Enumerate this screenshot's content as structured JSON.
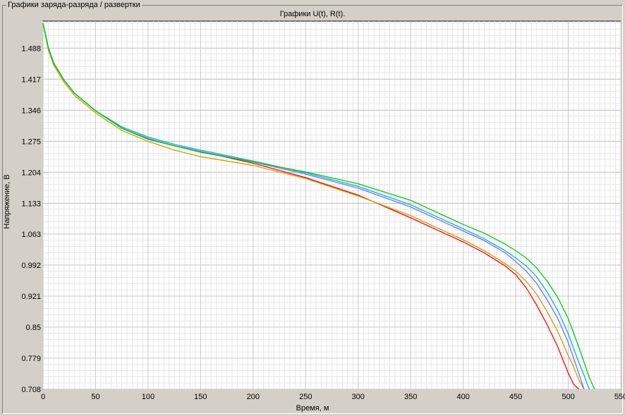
{
  "window": {
    "group_caption": "Графики заряда-разряда / развертки"
  },
  "chart_data": {
    "type": "line",
    "title": "Графики U(t), R(t).",
    "xlabel": "Время, м",
    "ylabel": "Напряжение, В",
    "xlim": [
      0,
      550
    ],
    "ylim": [
      0.708,
      1.55
    ],
    "x_ticks": [
      0,
      50,
      100,
      150,
      200,
      250,
      300,
      350,
      400,
      450,
      500,
      550
    ],
    "y_ticks": [
      0.708,
      0.779,
      0.85,
      0.921,
      0.992,
      1.063,
      1.133,
      1.204,
      1.275,
      1.346,
      1.417,
      1.488
    ],
    "grid": true,
    "legend": "none",
    "series": [
      {
        "color": "#ff0000",
        "x": [
          0,
          5,
          10,
          20,
          30,
          50,
          75,
          100,
          125,
          150,
          200,
          250,
          300,
          350,
          400,
          420,
          440,
          450,
          460,
          470,
          480,
          490,
          500,
          505,
          510
        ],
        "y": [
          1.545,
          1.49,
          1.455,
          1.415,
          1.385,
          1.345,
          1.305,
          1.28,
          1.265,
          1.252,
          1.225,
          1.192,
          1.152,
          1.1,
          1.045,
          1.02,
          0.99,
          0.97,
          0.94,
          0.9,
          0.855,
          0.805,
          0.745,
          0.72,
          0.708
        ]
      },
      {
        "color": "#c8a000",
        "x": [
          0,
          5,
          10,
          20,
          30,
          50,
          75,
          100,
          125,
          150,
          200,
          250,
          300,
          350,
          400,
          420,
          440,
          450,
          460,
          470,
          480,
          490,
          500,
          505,
          510,
          515
        ],
        "y": [
          1.545,
          1.485,
          1.45,
          1.41,
          1.38,
          1.34,
          1.3,
          1.275,
          1.255,
          1.24,
          1.22,
          1.19,
          1.15,
          1.105,
          1.05,
          1.025,
          0.995,
          0.978,
          0.955,
          0.925,
          0.885,
          0.84,
          0.785,
          0.76,
          0.73,
          0.708
        ]
      },
      {
        "color": "#7070ff",
        "x": [
          0,
          5,
          10,
          20,
          30,
          50,
          75,
          100,
          125,
          150,
          200,
          250,
          300,
          350,
          400,
          420,
          440,
          450,
          460,
          470,
          480,
          490,
          500,
          505,
          510,
          515
        ],
        "y": [
          1.545,
          1.49,
          1.455,
          1.415,
          1.385,
          1.345,
          1.305,
          1.282,
          1.265,
          1.252,
          1.228,
          1.2,
          1.168,
          1.125,
          1.07,
          1.048,
          1.02,
          1.0,
          0.978,
          0.95,
          0.912,
          0.87,
          0.815,
          0.78,
          0.745,
          0.708
        ]
      },
      {
        "color": "#00b4e0",
        "x": [
          0,
          5,
          10,
          20,
          30,
          50,
          75,
          100,
          125,
          150,
          200,
          250,
          300,
          350,
          400,
          420,
          440,
          450,
          460,
          470,
          480,
          490,
          500,
          510,
          515,
          520
        ],
        "y": [
          1.545,
          1.49,
          1.455,
          1.415,
          1.385,
          1.345,
          1.308,
          1.285,
          1.268,
          1.255,
          1.23,
          1.203,
          1.172,
          1.13,
          1.075,
          1.052,
          1.025,
          1.008,
          0.99,
          0.965,
          0.93,
          0.888,
          0.835,
          0.77,
          0.74,
          0.708
        ]
      },
      {
        "color": "#00cc00",
        "x": [
          0,
          5,
          10,
          20,
          30,
          50,
          75,
          100,
          125,
          150,
          200,
          250,
          300,
          350,
          400,
          420,
          440,
          450,
          460,
          470,
          480,
          490,
          500,
          510,
          515,
          520,
          525
        ],
        "y": [
          1.545,
          1.49,
          1.455,
          1.415,
          1.385,
          1.345,
          1.305,
          1.28,
          1.265,
          1.25,
          1.228,
          1.205,
          1.178,
          1.14,
          1.085,
          1.065,
          1.04,
          1.025,
          1.008,
          0.985,
          0.955,
          0.918,
          0.87,
          0.805,
          0.77,
          0.735,
          0.708
        ]
      }
    ]
  }
}
